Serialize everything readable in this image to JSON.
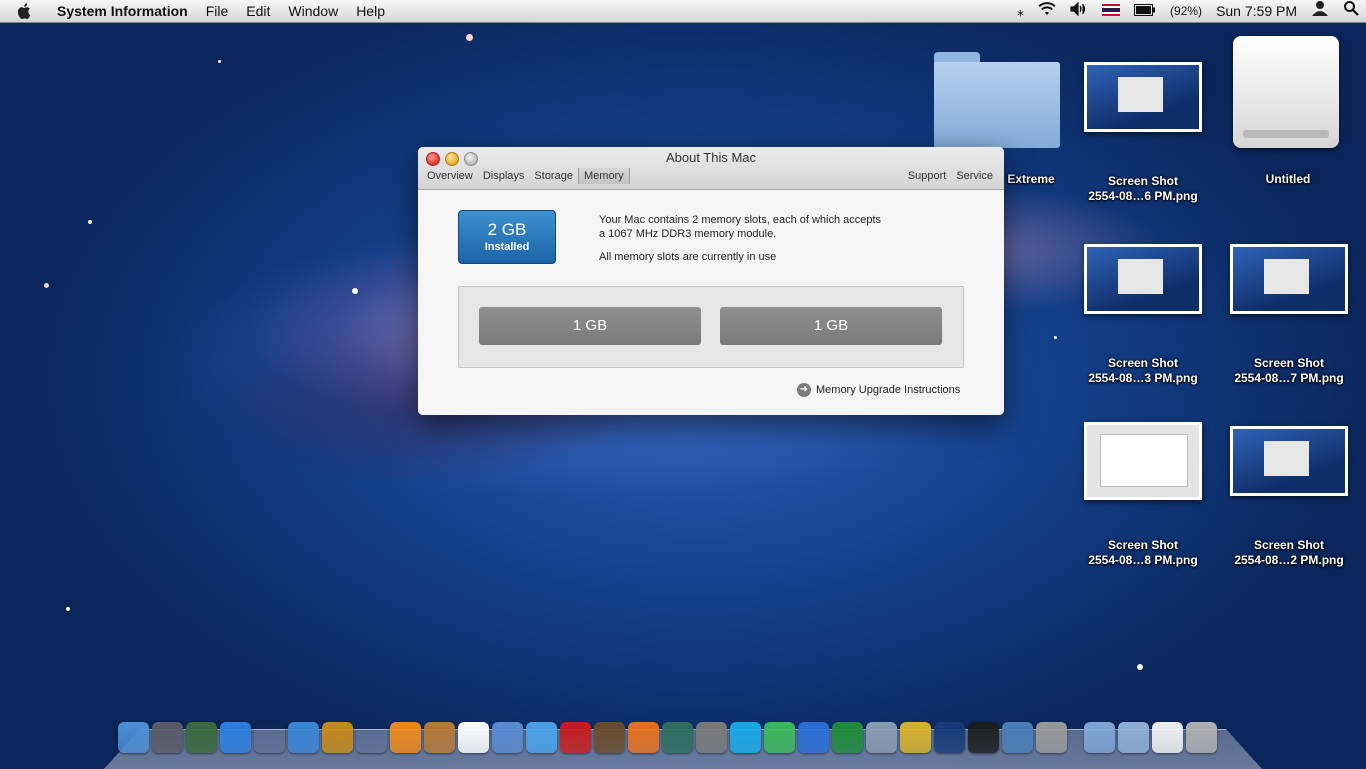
{
  "menubar": {
    "app_name": "System Information",
    "menus": [
      "File",
      "Edit",
      "Window",
      "Help"
    ],
    "battery": "(92%)",
    "clock": "Sun 7:59 PM"
  },
  "window": {
    "title": "About This Mac",
    "tabs": [
      "Overview",
      "Displays",
      "Storage",
      "Memory"
    ],
    "active_tab": "Memory",
    "right_tabs": [
      "Support",
      "Service"
    ],
    "installed_amount": "2 GB",
    "installed_label": "Installed",
    "description_line1": "Your Mac contains 2 memory slots, each of which accepts",
    "description_line2": "a 1067 MHz DDR3 memory module.",
    "status": "All memory slots are currently in use",
    "slots": [
      "1 GB",
      "1 GB"
    ],
    "upgrade_link": "Memory Upgrade Instructions"
  },
  "desktop": {
    "folder_label": "Extreme",
    "drive_label": "Untitled",
    "screenshots": [
      {
        "line1": "Screen Shot",
        "line2": "2554-08…6 PM.png"
      },
      {
        "line1": "Screen Shot",
        "line2": "2554-08…3 PM.png"
      },
      {
        "line1": "Screen Shot",
        "line2": "2554-08…7 PM.png"
      },
      {
        "line1": "Screen Shot",
        "line2": "2554-08…8 PM.png"
      },
      {
        "line1": "Screen Shot",
        "line2": "2554-08…2 PM.png"
      }
    ]
  },
  "dock": {
    "icons": [
      "finder-icon",
      "launchpad-icon",
      "mission-control-icon",
      "app-store-icon",
      "dashboard-icon",
      "safari-icon",
      "pineapple-icon",
      "clapperboard-icon",
      "vlc-icon",
      "address-book-icon",
      "ical-icon",
      "iphoto-icon",
      "itunes-icon",
      "red-app-icon",
      "image-capture-icon",
      "firefox-icon",
      "time-machine-icon",
      "system-preferences-icon",
      "skype-icon",
      "messenger-icon",
      "word-icon",
      "excel-icon",
      "facetime-icon",
      "stickies-icon",
      "photoshop-icon",
      "activity-monitor-icon",
      "preview-icon",
      "utility-icon",
      "applications-folder-icon",
      "documents-folder-icon",
      "document-icon",
      "trash-icon"
    ],
    "colors": [
      "#4c8fd6",
      "#5a5a66",
      "#3a6b3c",
      "#2d7fe0",
      "#222",
      "#3b86d6",
      "#c98a1a",
      "#222",
      "#f08a1a",
      "#b87a35",
      "#ffffff",
      "#5a8ad0",
      "#4aa3e8",
      "#c81d1d",
      "#6b4b2a",
      "#e8721c",
      "#2e6e5e",
      "#7a7a7a",
      "#18a9e6",
      "#3cba5c",
      "#2a6fd8",
      "#1f8c3a",
      "#8a9cb0",
      "#d9b22a",
      "#173b78",
      "#1d1d1d",
      "#4a7fb8",
      "#9a9a9a",
      "#7fa6d6",
      "#8fb0d8",
      "#f2f2f2",
      "#b0b0b0"
    ]
  }
}
